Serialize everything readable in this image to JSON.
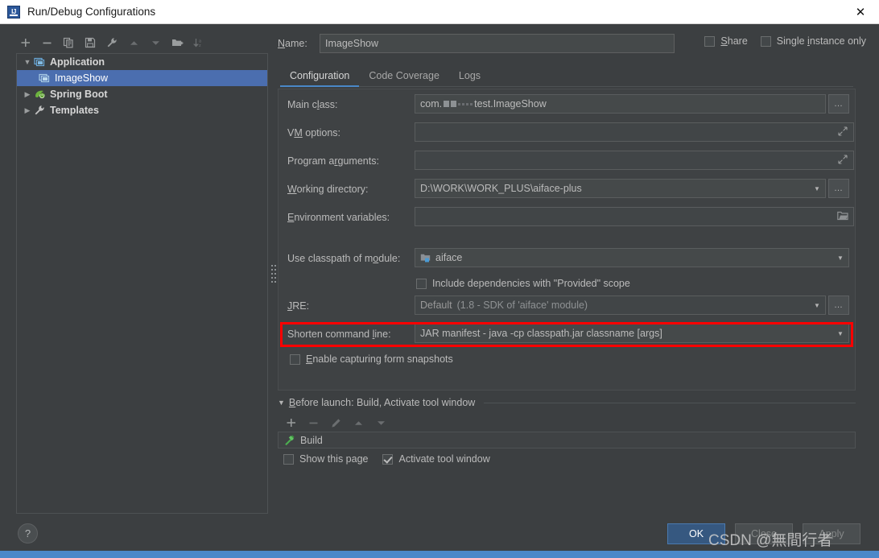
{
  "window": {
    "title": "Run/Debug Configurations",
    "app_icon": "intellij-idea-icon",
    "close_icon": "close-icon"
  },
  "toolbar": {
    "buttons": [
      {
        "name": "add-configuration-button",
        "icon": "plus-icon",
        "enabled": true
      },
      {
        "name": "remove-configuration-button",
        "icon": "minus-icon",
        "enabled": true
      },
      {
        "name": "copy-configuration-button",
        "icon": "copy-icon",
        "enabled": true
      },
      {
        "name": "save-configuration-button",
        "icon": "save-icon",
        "enabled": true
      },
      {
        "name": "edit-templates-button",
        "icon": "wrench-icon",
        "enabled": true
      },
      {
        "name": "move-up-button",
        "icon": "arrow-up-icon",
        "enabled": false
      },
      {
        "name": "move-down-button",
        "icon": "arrow-down-icon",
        "enabled": false
      },
      {
        "name": "create-folder-button",
        "icon": "folder-add-icon",
        "enabled": true
      },
      {
        "name": "sort-alphabetically-button",
        "icon": "sort-az-icon",
        "enabled": false
      }
    ]
  },
  "tree": {
    "nodes": [
      {
        "label": "Application",
        "icon": "application-icon",
        "expanded": true,
        "selected": false,
        "bold": true,
        "indent": 0
      },
      {
        "label": "ImageShow",
        "icon": "application-icon",
        "expanded": null,
        "selected": true,
        "bold": false,
        "indent": 1
      },
      {
        "label": "Spring Boot",
        "icon": "spring-boot-icon",
        "expanded": false,
        "selected": false,
        "bold": true,
        "indent": 0
      },
      {
        "label": "Templates",
        "icon": "wrench-icon",
        "expanded": false,
        "selected": false,
        "bold": true,
        "indent": 0
      }
    ]
  },
  "header": {
    "name_label": "Name:",
    "name_label_mnemonic": "N",
    "name_value": "ImageShow",
    "share": {
      "label": "Share",
      "mnemonic": "S",
      "checked": false
    },
    "single_instance": {
      "label_pre": "Single ",
      "mnemonic": "i",
      "label_post": "nstance only",
      "checked": false
    }
  },
  "tabs": [
    {
      "label": "Configuration",
      "active": true
    },
    {
      "label": "Code Coverage",
      "active": false
    },
    {
      "label": "Logs",
      "active": false
    }
  ],
  "form": {
    "main_class": {
      "label_pre": "Main c",
      "mnemonic": "l",
      "label_post": "ass:",
      "value_prefix": "com.",
      "value_suffix": "test.ImageShow",
      "redacted": true,
      "browse_icon": "ellipsis-icon"
    },
    "vm_options": {
      "label_pre": "V",
      "mnemonic": "M",
      "label_post": " options:",
      "value": "",
      "expand_icon": "expand-icon"
    },
    "program_arguments": {
      "label_pre": "Program a",
      "mnemonic": "r",
      "label_post": "guments:",
      "value": "",
      "expand_icon": "expand-icon"
    },
    "working_directory": {
      "label_pre": "",
      "mnemonic": "W",
      "label_post": "orking directory:",
      "value": "D:\\WORK\\WORK_PLUS\\aiface-plus",
      "dropdown_icon": "chevron-down-icon",
      "browse_icon": "ellipsis-icon"
    },
    "environment_variables": {
      "label_pre": "",
      "mnemonic": "E",
      "label_post": "nvironment variables:",
      "value": "",
      "browse_icon": "folder-icon"
    },
    "use_classpath_of_module": {
      "label_pre": "Use classpath of m",
      "mnemonic": "o",
      "label_post": "dule:",
      "value": "aiface",
      "value_icon": "module-icon",
      "dropdown_icon": "chevron-down-icon"
    },
    "include_provided": {
      "label_pre": "",
      "mnemonic": "",
      "label_post": "Include dependencies with \"Provided\" scope",
      "checked": false
    },
    "jre": {
      "label_pre": "",
      "mnemonic": "J",
      "label_post": "RE:",
      "value": "Default",
      "value_hint": "(1.8 - SDK of 'aiface' module)",
      "dropdown_icon": "chevron-down-icon",
      "browse_icon": "ellipsis-icon"
    },
    "shorten_command_line": {
      "label_pre": "Shorten command ",
      "mnemonic": "l",
      "label_post": "ine:",
      "value": "JAR manifest - java -cp classpath.jar classname [args]",
      "dropdown_icon": "chevron-down-icon",
      "highlighted": true,
      "highlight_color": "#ff0000"
    },
    "enable_form_snapshots": {
      "label_pre": "",
      "mnemonic": "E",
      "label_post": "nable capturing form snapshots",
      "checked": false
    }
  },
  "before_launch": {
    "title_pre": "",
    "mnemonic": "B",
    "title_post": "efore launch: Build, Activate tool window",
    "caret_icon": "chevron-down-icon",
    "toolbar": [
      {
        "name": "add-task-button",
        "icon": "plus-icon",
        "enabled": true
      },
      {
        "name": "remove-task-button",
        "icon": "minus-icon",
        "enabled": false
      },
      {
        "name": "edit-task-button",
        "icon": "pencil-icon",
        "enabled": false
      },
      {
        "name": "move-task-up-button",
        "icon": "arrow-up-icon",
        "enabled": false
      },
      {
        "name": "move-task-down-button",
        "icon": "arrow-down-icon",
        "enabled": false
      }
    ],
    "tasks": [
      {
        "label": "Build",
        "icon": "build-hammer-icon"
      }
    ],
    "show_this_page": {
      "label": "Show this page",
      "checked": false
    },
    "activate_tool_window": {
      "label": "Activate tool window",
      "checked": true
    }
  },
  "footer": {
    "help_label": "?",
    "ok_label": "OK",
    "close_label": "Close",
    "apply_label": "Apply"
  },
  "watermark": "CSDN @無間行者",
  "colors": {
    "background": "#3c3f41",
    "panel": "#3f4244",
    "field": "#45494a",
    "selection": "#4b6eaf",
    "accent": "#4a88c7",
    "primary_button": "#365880",
    "highlight": "#ff0000",
    "bottom_bar": "#4b88c9"
  }
}
